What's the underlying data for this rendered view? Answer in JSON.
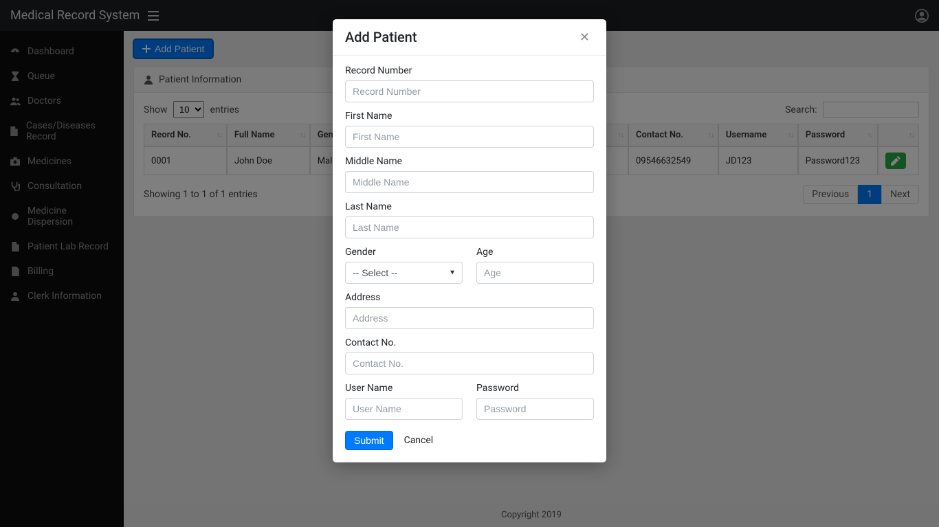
{
  "topbar": {
    "brand": "Medical Record System"
  },
  "sidebar": {
    "items": [
      {
        "label": "Dashboard"
      },
      {
        "label": "Queue"
      },
      {
        "label": "Doctors"
      },
      {
        "label": "Cases/Diseases Record"
      },
      {
        "label": "Medicines"
      },
      {
        "label": "Consultation"
      },
      {
        "label": "Medicine Dispersion"
      },
      {
        "label": "Patient Lab Record"
      },
      {
        "label": "Billing"
      },
      {
        "label": "Clerk Information"
      }
    ]
  },
  "toolbar": {
    "add_patient": "Add Patient"
  },
  "card": {
    "title": "Patient Information"
  },
  "datatable": {
    "show_label_pre": "Show",
    "show_value": "10",
    "show_label_post": "entries",
    "search_label": "Search:",
    "search_value": "",
    "columns": [
      "Reord No.",
      "Full Name",
      "Gender",
      "Contact No.",
      "Username",
      "Password",
      ""
    ],
    "rows": [
      {
        "record_no": "0001",
        "full_name": "John Doe",
        "gender": "Male",
        "contact": "09546632549",
        "username": "JD123",
        "password": "Password123"
      }
    ],
    "info": "Showing 1 to 1 of 1 entries",
    "pager": {
      "prev": "Previous",
      "pages": [
        "1"
      ],
      "next": "Next"
    }
  },
  "footer": {
    "text": "Copyright 2019"
  },
  "modal": {
    "title": "Add Patient",
    "fields": {
      "record_number": {
        "label": "Record Number",
        "placeholder": "Record Number"
      },
      "first_name": {
        "label": "First Name",
        "placeholder": "First Name"
      },
      "middle_name": {
        "label": "Middle Name",
        "placeholder": "Middle Name"
      },
      "last_name": {
        "label": "Last Name",
        "placeholder": "Last Name"
      },
      "gender": {
        "label": "Gender",
        "selected": "-- Select --"
      },
      "age": {
        "label": "Age",
        "placeholder": "Age"
      },
      "address": {
        "label": "Address",
        "placeholder": "Address"
      },
      "contact": {
        "label": "Contact No.",
        "placeholder": "Contact No."
      },
      "username": {
        "label": "User Name",
        "placeholder": "User Name"
      },
      "password": {
        "label": "Password",
        "placeholder": "Password"
      }
    },
    "actions": {
      "submit": "Submit",
      "cancel": "Cancel"
    }
  }
}
